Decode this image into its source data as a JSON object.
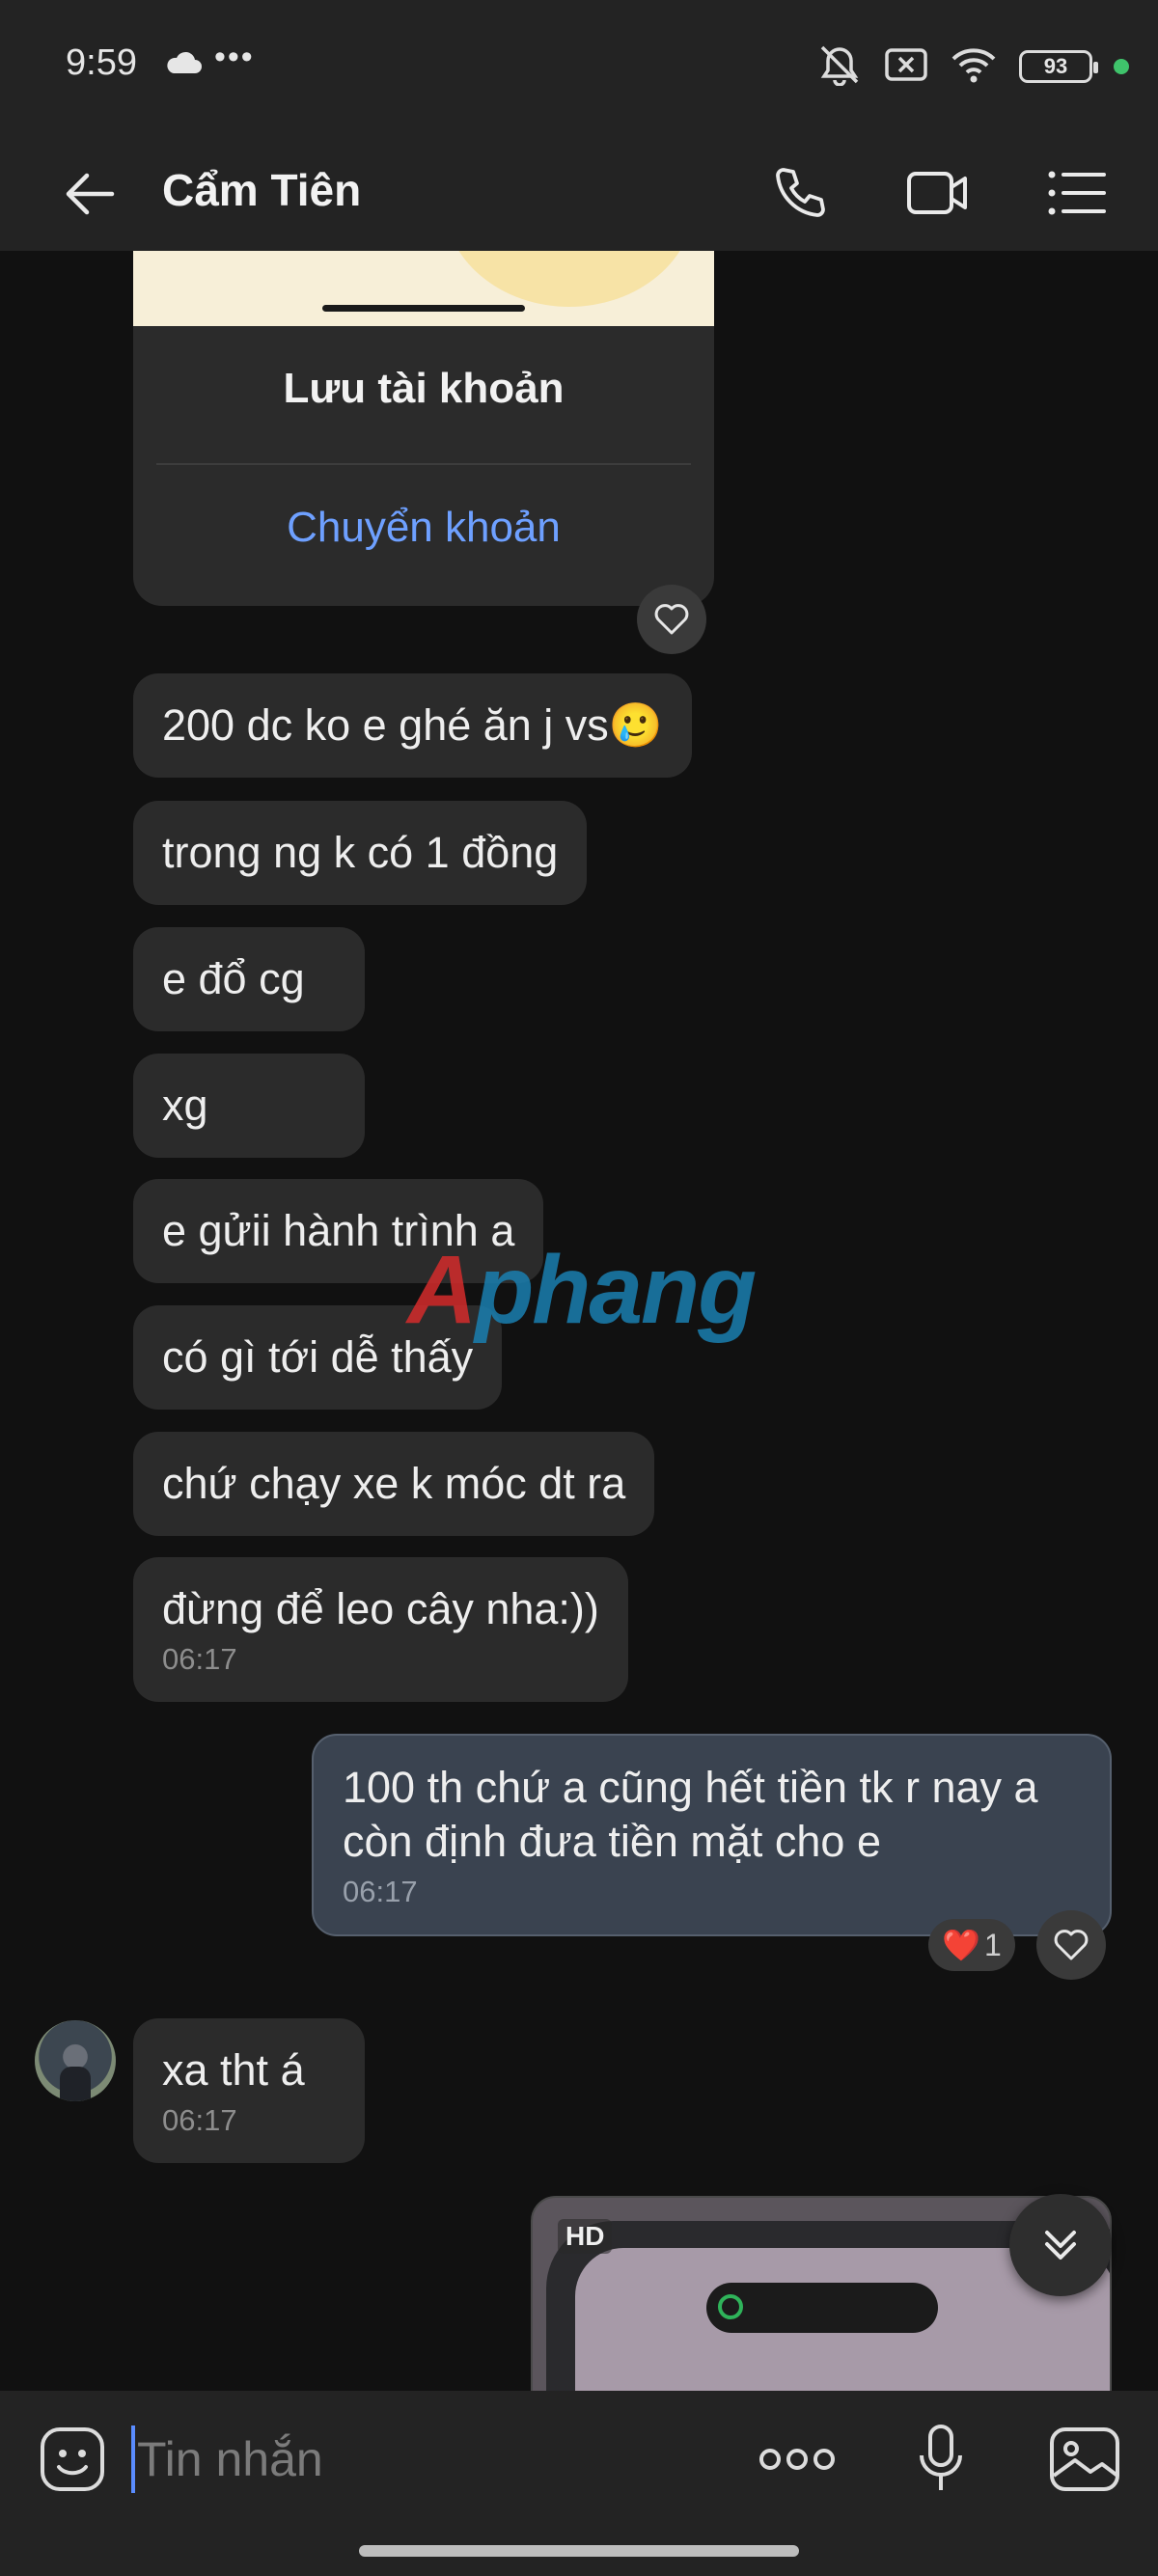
{
  "status_bar": {
    "time": "9:59",
    "more": "•••",
    "battery": "93"
  },
  "header": {
    "contact_name": "Cẩm Tiên"
  },
  "card": {
    "title": "Lưu tài khoản",
    "action": "Chuyển khoản"
  },
  "messages": [
    {
      "side": "in",
      "text": "200 dc ko e ghé ăn j vs🥲"
    },
    {
      "side": "in",
      "text": "trong ng k có 1 đồng"
    },
    {
      "side": "in",
      "text": "e đổ cg"
    },
    {
      "side": "in",
      "text": "xg"
    },
    {
      "side": "in",
      "text": "e gửii hành trình a"
    },
    {
      "side": "in",
      "text": "có gì tới dễ thấy"
    },
    {
      "side": "in",
      "text": "chứ chạy xe k móc dt ra"
    },
    {
      "side": "in",
      "text": "đừng để leo cây nha:))",
      "time": "06:17"
    },
    {
      "side": "out",
      "text": "100 th chứ a cũng hết tiền tk r nay a còn định đưa tiền mặt cho e",
      "time": "06:17",
      "reaction": {
        "emoji": "❤️",
        "count": "1"
      }
    },
    {
      "side": "in",
      "text": "xa tht á",
      "time": "06:17"
    }
  ],
  "media": {
    "badge": "HD"
  },
  "watermark": {
    "part1": "A",
    "part2": "phang"
  },
  "composer": {
    "placeholder": "Tin nhắn"
  }
}
